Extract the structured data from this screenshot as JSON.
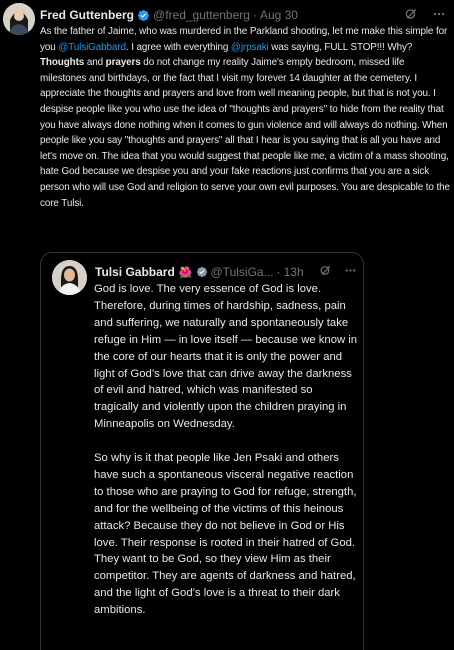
{
  "tweet": {
    "author_name": "Fred Guttenberg",
    "handle": "@fred_guttenberg",
    "separator": "·",
    "time": "Aug 30",
    "body": [
      {
        "t": "text",
        "v": "As the father of Jaime, who was murdered in the Parkland shooting, let me make this simple for you "
      },
      {
        "t": "link",
        "v": "@TulsiGabbard"
      },
      {
        "t": "text",
        "v": ".  I agree with everything "
      },
      {
        "t": "link",
        "v": "@jrpsaki"
      },
      {
        "t": "text",
        "v": " was saying, FULL STOP!!!  Why?  "
      },
      {
        "t": "bold",
        "v": "Thoughts"
      },
      {
        "t": "text",
        "v": " and "
      },
      {
        "t": "bold",
        "v": "prayers"
      },
      {
        "t": "text",
        "v": " do not change my reality Jaime's empty bedroom, missed life milestones and birthdays, or the fact that I visit my forever 14 daughter at the cemetery.  I appreciate the thoughts and prayers and love from well meaning people, but that is not you.  I despise people like you who use the idea of \"thoughts and prayers\" to hide from the reality that you have always done nothing when it comes to gun violence and will always do nothing.  When people like you say \"thoughts and prayers\" all that I hear is you saying that is all you have and let's move on.  The idea that you would suggest that people like me, a victim of a mass shooting, hate God because we despise you and your fake reactions just confirms that you are a sick person who will use God and religion to serve your own evil purposes. You are despicable to the core Tulsi."
      }
    ]
  },
  "quote": {
    "author_name": "Tulsi Gabbard",
    "flower": "🌺",
    "handle": "@TulsiGa...",
    "separator": "·",
    "time": "13h",
    "paragraphs": [
      "God is love. The very essence of God is love. Therefore, during times of hardship, sadness, pain and suffering, we naturally and spontaneously take refuge in Him — in love itself — because we know in the core of our hearts that it is only the power and light of God’s love that can drive away the darkness of evil and hatred, which was manifested so tragically and violently upon the children praying in Minneapolis on Wednesday.",
      "So why is it that people like Jen Psaki and others have such a spontaneous visceral negative reaction to those who are praying to God for refuge, strength, and for the wellbeing of the victims of this heinous attack? Because they do not believe in God or His love. Their response is rooted in their hatred of God. They want to be God, so they view Him as their competitor. They are agents of darkness and hatred, and the light of God’s love is a threat to their dark ambitions."
    ]
  },
  "colors": {
    "background": "#000000",
    "text": "#e7e9ea",
    "muted": "#71767b",
    "link": "#1d9bf0",
    "verified_blue": "#1d9bf0",
    "verified_gold": "#829aab",
    "border": "#2f3336"
  },
  "icons": {
    "verified": "verified-badge-icon",
    "grok": "grok-icon",
    "more": "more-options-icon"
  }
}
